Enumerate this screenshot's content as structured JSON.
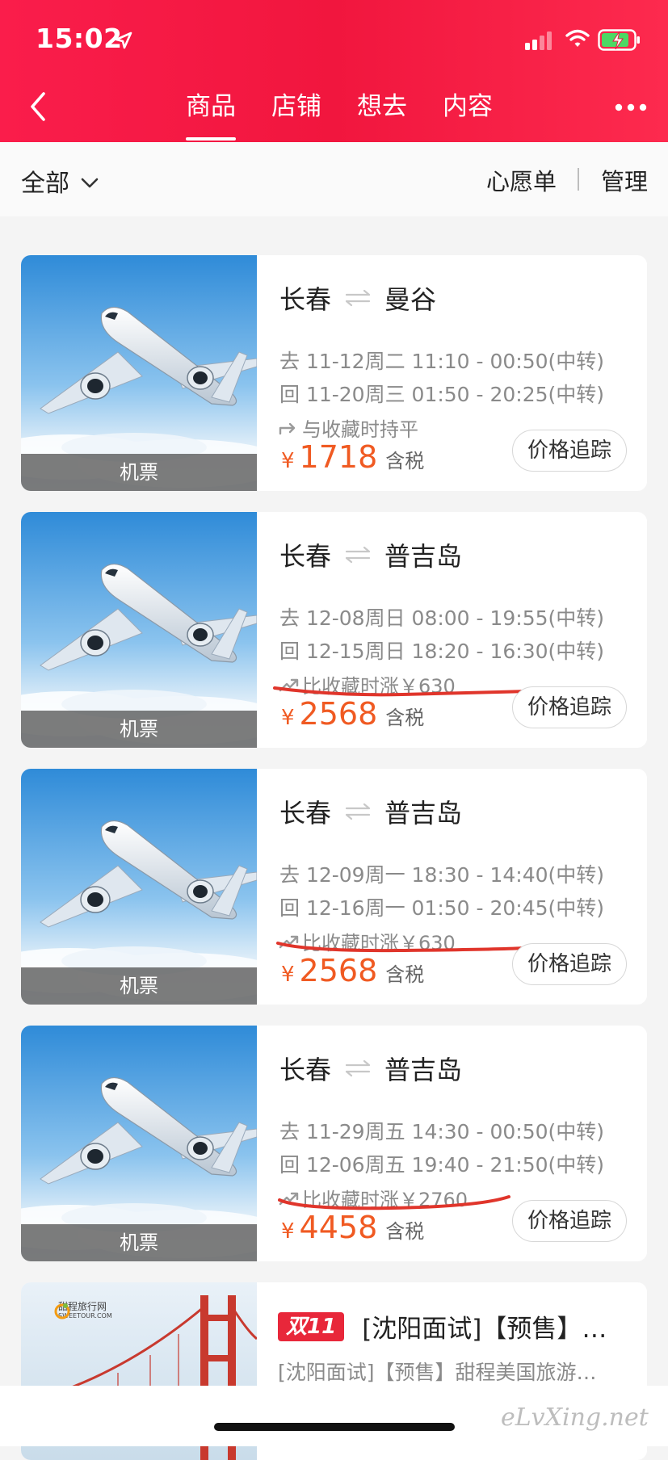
{
  "status": {
    "time": "15:02"
  },
  "nav": {
    "tabs": [
      {
        "label": "商品",
        "active": true
      },
      {
        "label": "店铺",
        "active": false
      },
      {
        "label": "想去",
        "active": false
      },
      {
        "label": "内容",
        "active": false
      }
    ]
  },
  "filter": {
    "all_label": "全部",
    "wishlist_label": "心愿单",
    "manage_label": "管理"
  },
  "common": {
    "caption": "机票",
    "track_label": "价格追踪",
    "yen": "¥",
    "tax_label": "含税"
  },
  "cards": [
    {
      "from": "长春",
      "to": "曼谷",
      "depart": "去 11-12周二 11:10 - 00:50(中转)",
      "return": "回 11-20周三 01:50 - 20:25(中转)",
      "trend": "与收藏时持平",
      "trend_type": "flat",
      "price": "1718"
    },
    {
      "from": "长春",
      "to": "普吉岛",
      "depart": "去 12-08周日 08:00 - 19:55(中转)",
      "return": "回 12-15周日 18:20 - 16:30(中转)",
      "trend": "比收藏时涨￥630",
      "trend_type": "up",
      "price": "2568"
    },
    {
      "from": "长春",
      "to": "普吉岛",
      "depart": "去 12-09周一 18:30 - 14:40(中转)",
      "return": "回 12-16周一 01:50 - 20:45(中转)",
      "trend": "比收藏时涨￥630",
      "trend_type": "up",
      "price": "2568"
    },
    {
      "from": "长春",
      "to": "普吉岛",
      "depart": "去 11-29周五 14:30 - 00:50(中转)",
      "return": "回 12-06周五 19:40 - 21:50(中转)",
      "trend": "比收藏时涨￥2760",
      "trend_type": "up",
      "price": "4458"
    }
  ],
  "promo": {
    "badge": "双11",
    "title": "[沈阳面试]【预售】…",
    "subtitle": "[沈阳面试]【预售】甜程美国旅游…",
    "logo_cn": "甜程旅行网",
    "logo_en": "SWEETOUR.COM"
  },
  "watermark": "eLvXing.net",
  "colors": {
    "header": "#f1163e",
    "price": "#f05a22",
    "underline": "#e0352b",
    "badge": "#e8273a"
  }
}
